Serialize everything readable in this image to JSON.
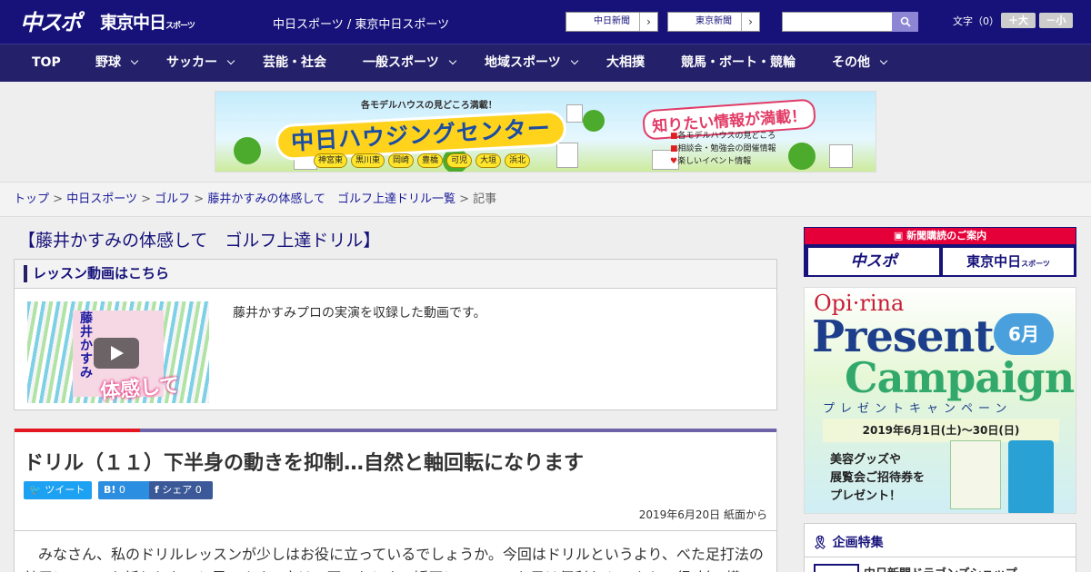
{
  "header": {
    "logo_main": "中スポ",
    "logo_sub": "東京中日",
    "logo_sub_small": "スポーツ",
    "site_link": "中日スポーツ / 東京中日スポーツ",
    "paper_buttons": [
      "中日新聞",
      "東京新聞"
    ],
    "search_placeholder": "",
    "font_size_label": "文字（0）",
    "font_plus": "＋大",
    "font_minus": "－小"
  },
  "nav": {
    "items": [
      {
        "label": "TOP"
      },
      {
        "label": "野球"
      },
      {
        "label": "サッカー"
      },
      {
        "label": "芸能・社会"
      },
      {
        "label": "一般スポーツ"
      },
      {
        "label": "地域スポーツ"
      },
      {
        "label": "大相撲"
      },
      {
        "label": "競馬・ボート・競輪"
      },
      {
        "label": "その他"
      }
    ]
  },
  "banner": {
    "top_text": "各モデルハウスの見どころ満載！",
    "title": "中日ハウジングセンター",
    "right_title": "知りたい情報が満載！",
    "list": [
      "各モデルハウスの見どころ",
      "相談会・勉強会の開催情報",
      "楽しいイベント情報"
    ],
    "cities": [
      "神宮東",
      "黒川東",
      "岡崎",
      "豊橋",
      "可児",
      "大垣",
      "浜北"
    ]
  },
  "breadcrumb": {
    "items": [
      "トップ",
      "中日スポーツ",
      "ゴルフ",
      "藤井かすみの体感して　ゴルフ上達ドリル一覧"
    ],
    "current": "記事",
    "separator": ">"
  },
  "page_title": "【藤井かすみの体感して　ゴルフ上達ドリル】",
  "lesson": {
    "heading": "レッスン動画はこちら",
    "thumb_text": "藤井かすみ",
    "thumb_text2": "体感して",
    "description": "藤井かすみプロの実演を収録した動画です。"
  },
  "article": {
    "title": "ドリル（１１）下半身の動きを抑制…自然と軸回転になります",
    "share": {
      "tweet": "ツイート",
      "hatena_count": "0",
      "facebook": "シェア 0"
    },
    "date": "2019年6月20日 紙面から",
    "body": "みなさん、私のドリルレッスンが少しはお役に立っているでしょうか。今回はドリルというより、べた足打法の効用についてお話ししたいと思います。実は、団…たときの矯正に、このべた足は便利なんですよ。（取材・構"
  },
  "sidebar": {
    "subscribe_heading": "新聞購読のご案内",
    "subscribe_buttons": [
      "中スポ",
      "東京中日"
    ],
    "subscribe_small": "スポーツ",
    "ad": {
      "brand": "Opi·rina",
      "present": "Present",
      "campaign": "Campaign",
      "month": "6月",
      "sub": "プレゼントキャンペーン",
      "date": "2019年6月1日(土)～30日(日)",
      "text": [
        "美容グッズや",
        "展覧会ご招待券を",
        "プレゼント！"
      ]
    },
    "feature_heading": "企画特集",
    "feature_item": "中日新聞ドラゴンズショップ"
  }
}
